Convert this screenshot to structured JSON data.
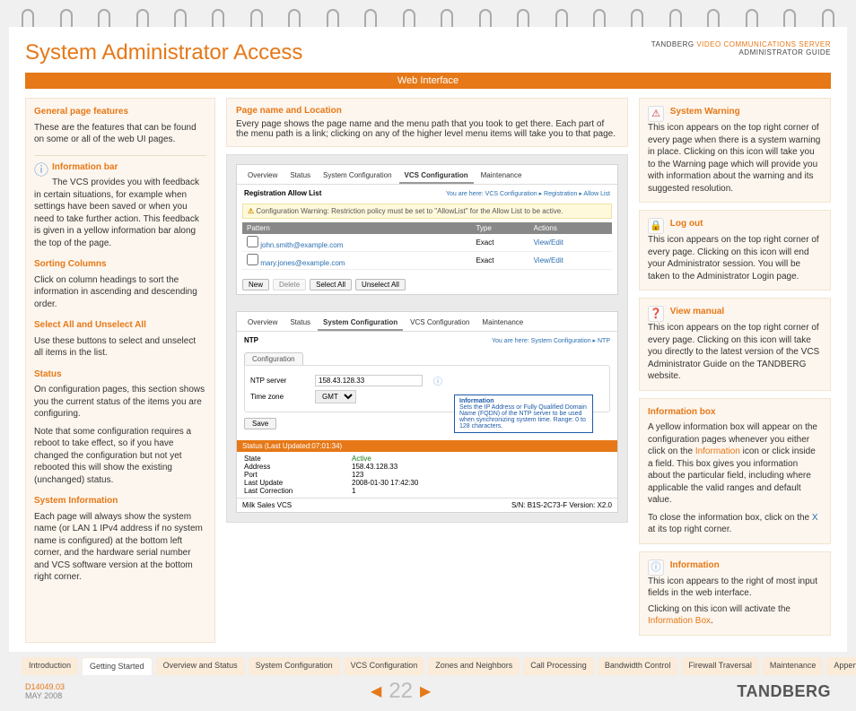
{
  "header": {
    "title": "System Administrator Access",
    "brand_line1_a": "TANDBERG ",
    "brand_line1_b": "VIDEO COMMUNICATIONS SERVER",
    "brand_line2": "ADMINISTRATOR GUIDE"
  },
  "orange_bar": "Web Interface",
  "left": {
    "gpf": {
      "h": "General page features",
      "p": "These are the features that can be found on some or all of the web UI pages."
    },
    "info_bar": {
      "h": "Information bar",
      "p": "The VCS provides you with feedback in certain situations, for example when settings have been saved or when you need to take further action.  This feedback is given in a yellow information bar along the top of the page."
    },
    "sort": {
      "h": "Sorting Columns",
      "p": "Click on column headings to sort the information in ascending and descending order."
    },
    "selun": {
      "h": "Select All and Unselect All",
      "p": "Use these buttons to select and unselect all items in the list."
    },
    "status": {
      "h": "Status",
      "p1": "On configuration pages, this section shows you the current status of the items you are configuring.",
      "p2": "Note that some configuration requires a reboot to take effect, so if you have changed the configuration but not yet rebooted this will show the existing (unchanged) status."
    },
    "sysinfo": {
      "h": "System Information",
      "p": "Each page will always show the system name (or LAN 1 IPv4 address if no system name is configured) at the bottom left corner, and the hardware serial number and VCS software version at the bottom right corner."
    }
  },
  "mid": {
    "pnl": {
      "h": "Page name and Location",
      "p": "Every page shows the page name and the menu path that you took to get there.  Each part of the menu path is a link; clicking on any of the higher level menu items will take you to that page."
    },
    "shot1": {
      "tabs": [
        "Overview",
        "Status",
        "System Configuration",
        "VCS Configuration",
        "Maintenance"
      ],
      "active_idx": 3,
      "title": "Registration Allow List",
      "crumb": "You are here: VCS Configuration ▸ Registration ▸ Allow List",
      "warn": "Configuration Warning: Restriction policy must be set to \"AllowList\" for the Allow List to be active.",
      "th": [
        "Pattern",
        "Type",
        "Actions"
      ],
      "rows": [
        {
          "pattern": "john.smith@example.com",
          "type": "Exact",
          "actions": "View/Edit"
        },
        {
          "pattern": "mary.jones@example.com",
          "type": "Exact",
          "actions": "View/Edit"
        }
      ],
      "btns": [
        "New",
        "Delete",
        "Select All",
        "Unselect All"
      ]
    },
    "shot2": {
      "tabs": [
        "Overview",
        "Status",
        "System Configuration",
        "VCS Configuration",
        "Maintenance"
      ],
      "active_idx": 2,
      "title": "NTP",
      "crumb": "You are here: System Configuration ▸ NTP",
      "conf_tab": "Configuration",
      "ntp_label": "NTP server",
      "ntp_value": "158.43.128.33",
      "tz_label": "Time zone",
      "tz_value": "GMT",
      "save": "Save",
      "info_pop": {
        "h": "Information",
        "body": "Sets the IP Address or Fully Qualified Domain Name (FQDN) of the NTP server to be used when synchronizing system time.\nRange: 0 to 128 characters."
      },
      "status_bar": "Status (Last Updated:07:01:34)",
      "stat": {
        "state_l": "State",
        "state_v": "Active",
        "addr_l": "Address",
        "addr_v": "158.43.128.33",
        "port_l": "Port",
        "port_v": "123",
        "lu_l": "Last Update",
        "lu_v": "2008-01-30 17:42:30",
        "lc_l": "Last Correction",
        "lc_v": "1"
      },
      "footer_l": "Milk Sales VCS",
      "footer_r": "S/N: B1S-2C73-F  Version: X2.0"
    }
  },
  "right": {
    "sw": {
      "h": "System Warning",
      "p": "This icon appears on the top right corner of every page when there is a system warning in place. Clicking on this icon will take you to the Warning page which will provide you with information about the warning and its suggested resolution."
    },
    "lo": {
      "h": "Log out",
      "p": "This icon appears on the top right corner of every page. Clicking on this icon will end your Administrator session.  You will be taken to the Administrator Login page."
    },
    "vm": {
      "h": "View manual",
      "p": "This icon appears on the top right corner of every page. Clicking on this icon will take you directly to the latest version of the VCS Administrator Guide on the TANDBERG website."
    },
    "ib": {
      "h": "Information box",
      "p1a": "A yellow information box will appear on the configuration pages whenever you either click on the ",
      "p1link": "Information",
      "p1b": " icon or click inside a field. This box gives you information about the particular field, including where applicable the valid ranges and default value.",
      "p2a": "To close the information box, click on the ",
      "p2link": "X",
      "p2b": " at its top right corner."
    },
    "inf": {
      "h": "Information",
      "p1": "This icon appears to the right of most input fields in the web interface.",
      "p2a": "Clicking on this icon will activate the ",
      "link": "Information Box",
      "p2b": "."
    }
  },
  "nav": [
    "Introduction",
    "Getting Started",
    "Overview and Status",
    "System Configuration",
    "VCS Configuration",
    "Zones and Neighbors",
    "Call Processing",
    "Bandwidth Control",
    "Firewall Traversal",
    "Maintenance",
    "Appendices"
  ],
  "nav_active": 1,
  "footer": {
    "docid": "D14049.03",
    "date": "MAY 2008",
    "page": "22",
    "brand": "TANDBERG"
  }
}
